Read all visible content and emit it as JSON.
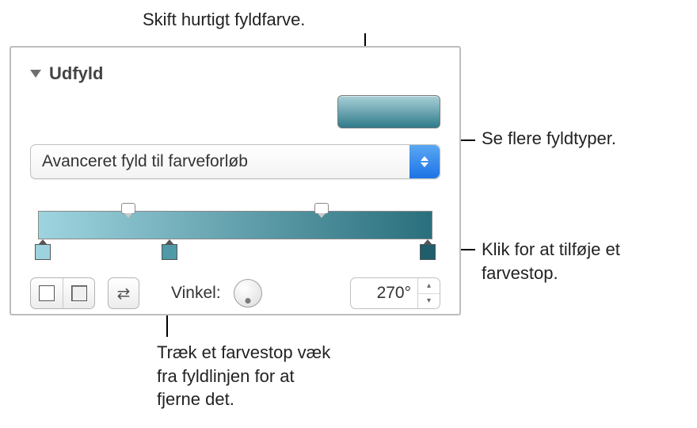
{
  "callouts": {
    "swatch": "Skift hurtigt fyldfarve.",
    "dropdown": "Se flere fyldtyper.",
    "addstop": "Klik for at tilføje et farvestop.",
    "removestop": "Træk et farvestop væk fra fyldlinjen for at fjerne det."
  },
  "panel": {
    "section_title": "Udfyld",
    "fill_type": "Avanceret fyld til farveforløb",
    "angle_label": "Vinkel:",
    "angle_value": "270°",
    "gradient": {
      "start_color": "#9ed4df",
      "end_color": "#2a6f7d",
      "opacity_markers_pct": [
        24,
        71
      ],
      "color_stops": [
        {
          "pct": 3,
          "color": "#9cd3de"
        },
        {
          "pct": 34,
          "color": "#4f9aa6"
        },
        {
          "pct": 97,
          "color": "#1f5f6c"
        }
      ]
    }
  }
}
